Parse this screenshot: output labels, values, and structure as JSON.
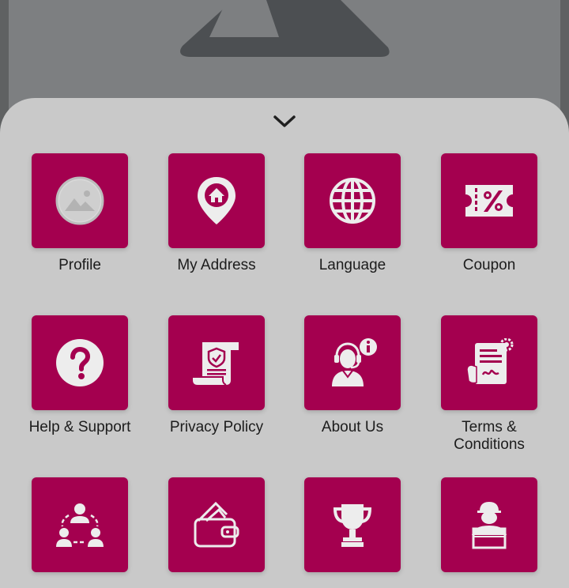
{
  "background": {
    "logo_icon": "triangle-logo",
    "overlay_color": "#5f6162"
  },
  "sheet": {
    "background_color": "#c9c9c9",
    "collapse_icon": "chevron-down-icon"
  },
  "accent_color": "#a4004f",
  "menu": {
    "profile": {
      "label": "Profile",
      "icon": "image-placeholder-icon"
    },
    "my_address": {
      "label": "My Address",
      "icon": "location-pin-home-icon"
    },
    "language": {
      "label": "Language",
      "icon": "globe-icon"
    },
    "coupon": {
      "label": "Coupon",
      "icon": "coupon-percent-icon"
    },
    "help_support": {
      "label": "Help & Support",
      "icon": "question-circle-icon"
    },
    "privacy_policy": {
      "label": "Privacy Policy",
      "icon": "policy-scroll-shield-icon"
    },
    "about_us": {
      "label": "About Us",
      "icon": "support-agent-info-icon"
    },
    "terms": {
      "label_line1": "Terms &",
      "label_line2": "Conditions",
      "icon": "contract-signature-icon"
    },
    "team": {
      "icon": "team-network-icon"
    },
    "wallet": {
      "icon": "wallet-icon"
    },
    "trophy": {
      "icon": "trophy-icon"
    },
    "delivery": {
      "icon": "delivery-person-icon"
    }
  }
}
